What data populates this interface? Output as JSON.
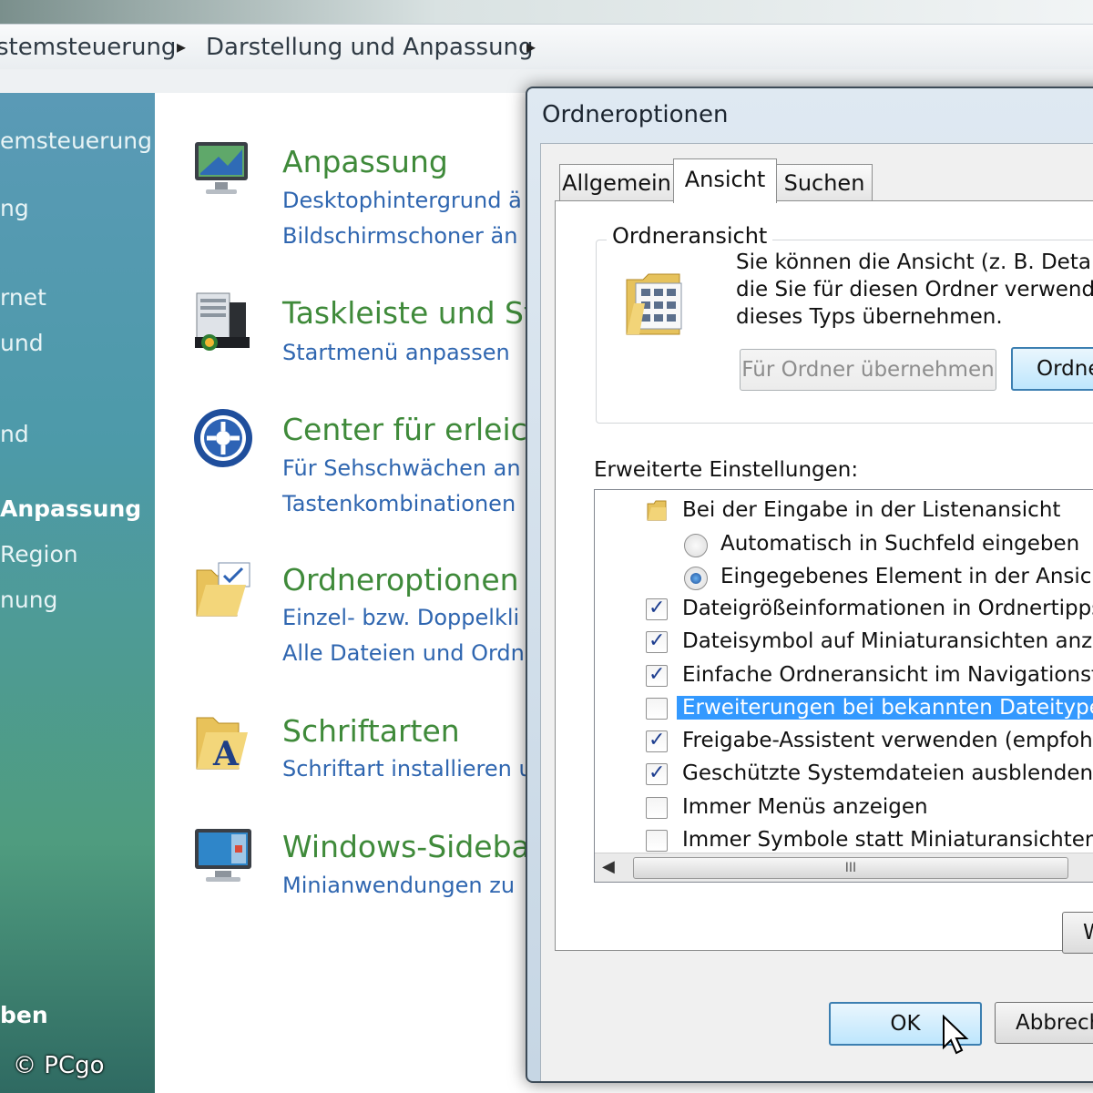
{
  "breadcrumb": {
    "items": [
      "stemsteuerung",
      "Darstellung und Anpassung"
    ],
    "separator": "▸"
  },
  "sidebar": {
    "items": [
      {
        "label": "emsteuerung",
        "bold": false
      },
      {
        "label": "ng",
        "bold": false
      },
      {
        "label": "rnet",
        "bold": false
      },
      {
        "label": "und",
        "bold": false
      },
      {
        "label": "nd",
        "bold": false
      },
      {
        "label": "Anpassung",
        "bold": true
      },
      {
        "label": "Region",
        "bold": false
      },
      {
        "label": "nung",
        "bold": false
      },
      {
        "label": "ben",
        "bold": true
      }
    ],
    "watermark": "© PCgo"
  },
  "categories": [
    {
      "title": "Anpassung",
      "links": [
        "Desktophintergrund ä",
        "Bildschirmschoner än"
      ],
      "icon": "display-icon"
    },
    {
      "title": "Taskleiste und St",
      "links": [
        "Startmenü anpassen"
      ],
      "icon": "taskbar-icon"
    },
    {
      "title": "Center für erleich",
      "links": [
        "Für Sehschwächen an",
        "Tastenkombinationen"
      ],
      "icon": "ease-of-access-icon"
    },
    {
      "title": "Ordneroptionen",
      "links": [
        "Einzel- bzw. Doppelkli",
        "Alle Dateien und Ordn"
      ],
      "icon": "folder-options-icon"
    },
    {
      "title": "Schriftarten",
      "links": [
        "Schriftart installieren u"
      ],
      "icon": "fonts-folder-icon"
    },
    {
      "title": "Windows-Sideba",
      "links": [
        "Minianwendungen zu"
      ],
      "icon": "sidebar-icon"
    }
  ],
  "dialog": {
    "title": "Ordneroptionen",
    "tabs": [
      "Allgemein",
      "Ansicht",
      "Suchen"
    ],
    "active_tab": "Ansicht",
    "group_title": "Ordneransicht",
    "description": [
      "Sie können die Ansicht (z. B. Details",
      "die Sie für diesen Ordner verwenden",
      "dieses Typs übernehmen."
    ],
    "apply_button": "Für Ordner übernehmen",
    "reset_button": "Ordne",
    "advanced_label": "Erweiterte Einstellungen:",
    "settings": [
      {
        "type": "folder",
        "label": "Bei der Eingabe in der Listenansicht"
      },
      {
        "type": "radio",
        "label": "Automatisch in Suchfeld eingeben",
        "checked": false
      },
      {
        "type": "radio",
        "label": "Eingegebenes Element in der Ansicht a",
        "checked": true
      },
      {
        "type": "checkbox",
        "label": "Dateigrößeinformationen in Ordnertipps anz",
        "checked": true
      },
      {
        "type": "checkbox",
        "label": "Dateisymbol auf Miniaturansichten anzeige",
        "checked": true
      },
      {
        "type": "checkbox",
        "label": "Einfache Ordneransicht im Navigationsfens",
        "checked": true
      },
      {
        "type": "checkbox",
        "label": "Erweiterungen bei bekannten Dateitypen a",
        "checked": false,
        "selected": true
      },
      {
        "type": "checkbox",
        "label": "Freigabe-Assistent verwenden (empfohlen)",
        "checked": true
      },
      {
        "type": "checkbox",
        "label": "Geschützte Systemdateien ausblenden (em",
        "checked": true
      },
      {
        "type": "checkbox",
        "label": "Immer Menüs anzeigen",
        "checked": false
      },
      {
        "type": "checkbox",
        "label": "Immer Symbole statt Miniaturansichten anz",
        "checked": false
      }
    ],
    "restore_button": "W",
    "scroll_grip": "III",
    "ok_button": "OK",
    "cancel_button": "Abbrech"
  }
}
